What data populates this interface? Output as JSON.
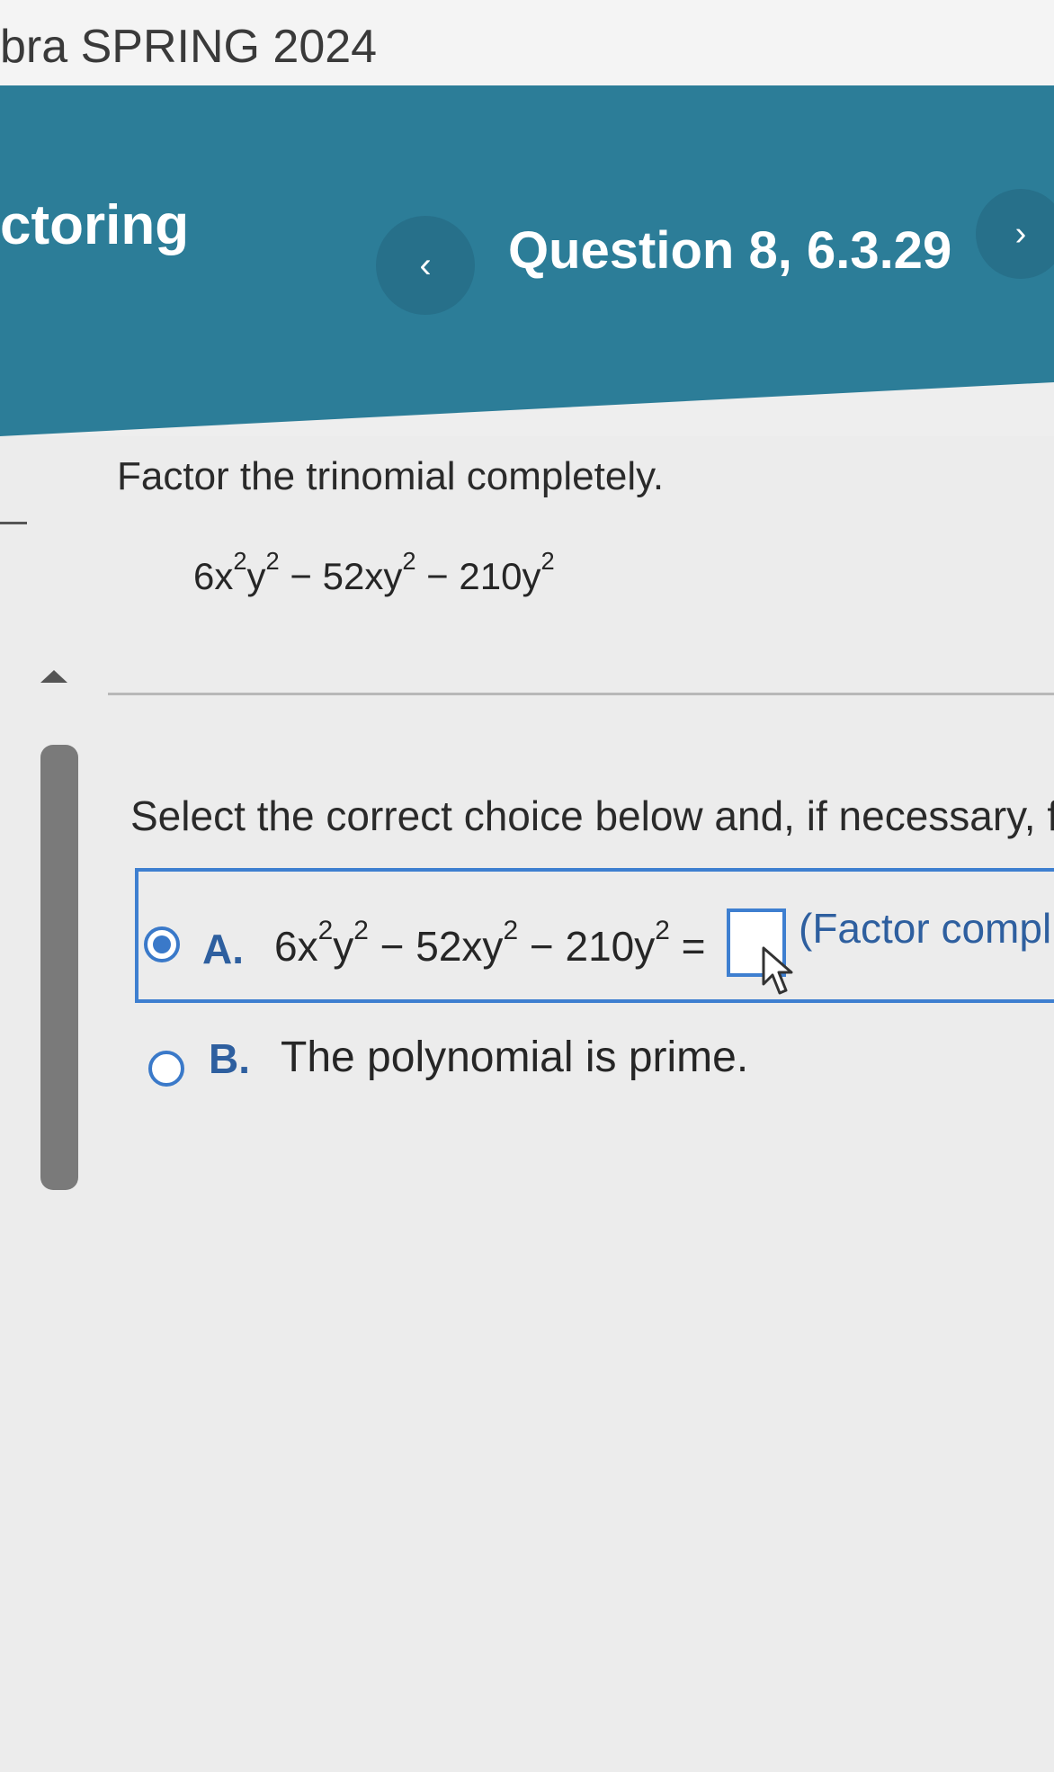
{
  "course": {
    "title": "bra SPRING 2024"
  },
  "header": {
    "section_title": "ctoring",
    "question_label": "Question 8, 6.3.29",
    "prev_icon": "chevron-left-icon",
    "next_icon": "chevron-right-icon",
    "prev_glyph": "‹",
    "next_glyph": "›"
  },
  "problem": {
    "instruction": "Factor the trinomial completely.",
    "expression": {
      "t1": "6x",
      "t1_exp1": "2",
      "t2": "y",
      "t2_exp": "2",
      "t3": " − 52xy",
      "t3_exp": "2",
      "t4": " − 210y",
      "t4_exp": "2"
    }
  },
  "prompt": "Select the correct choice below and, if necessary, fi",
  "choices": [
    {
      "letter": "A.",
      "selected": true,
      "expression": {
        "t1": "6x",
        "t1_exp": "2",
        "t2": "y",
        "t2_exp": "2",
        "t3": " − 52xy",
        "t3_exp": "2",
        "t4": " − 210y",
        "t4_exp": "2",
        "eq": " ="
      },
      "answer_value": "",
      "hint": "(Factor compl"
    },
    {
      "letter": "B.",
      "selected": false,
      "text": "The polynomial is prime."
    }
  ],
  "colors": {
    "header_bg": "#2c7d98",
    "accent_blue": "#3e7fd0",
    "choice_text": "#2e5f9f"
  }
}
